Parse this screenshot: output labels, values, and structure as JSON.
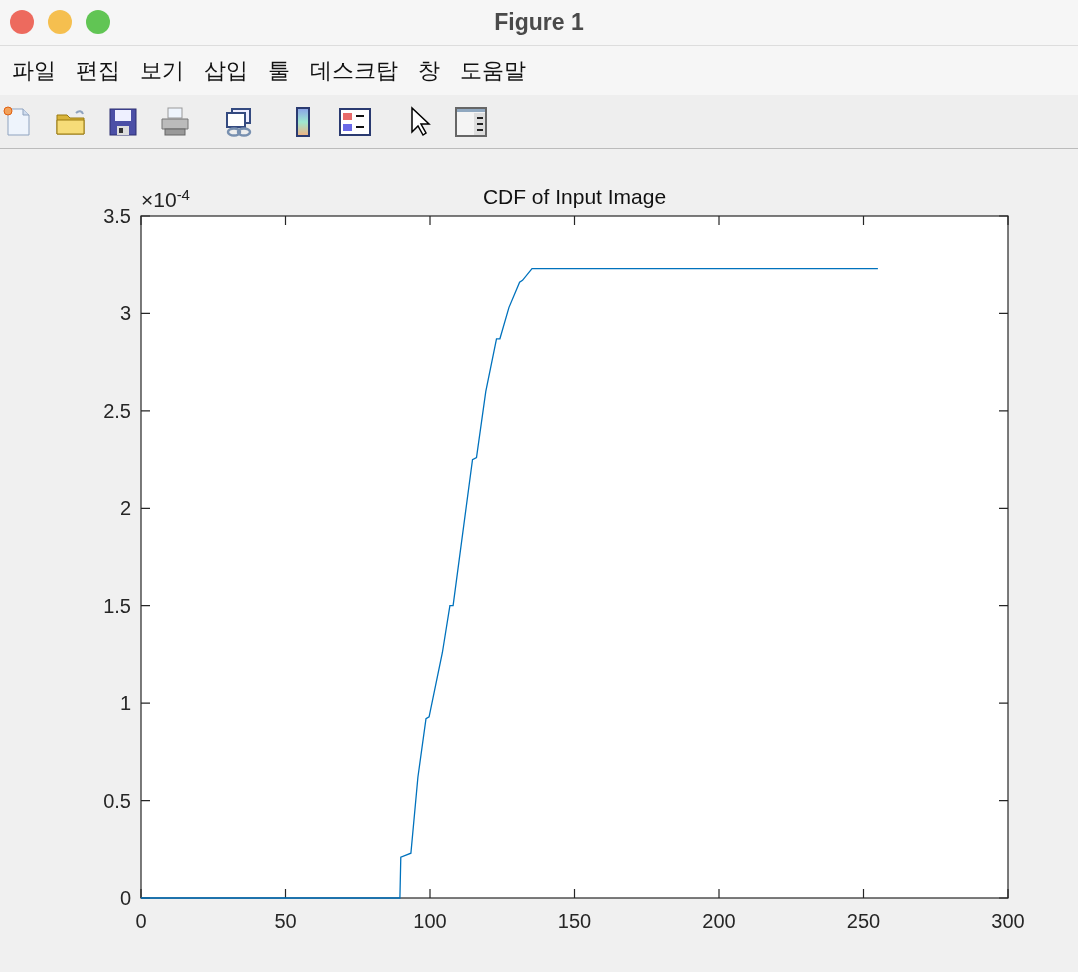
{
  "window": {
    "title": "Figure 1"
  },
  "menu": [
    "파일",
    "편집",
    "보기",
    "삽입",
    "툴",
    "데스크탑",
    "창",
    "도움말"
  ],
  "toolbar": [
    {
      "kind": "new"
    },
    {
      "kind": "open"
    },
    {
      "kind": "save"
    },
    {
      "kind": "print"
    },
    {
      "kind": "link"
    },
    {
      "kind": "colorbar"
    },
    {
      "kind": "legend"
    },
    {
      "kind": "pointer"
    },
    {
      "kind": "panel"
    }
  ],
  "axes": {
    "exponent_label": "×10$^{-4}$",
    "chart_data": {
      "type": "line",
      "title": "CDF of Input Image",
      "x": [
        0,
        89.6,
        89.9,
        93.4,
        95.8,
        98.6,
        99.7,
        104.3,
        106.9,
        108,
        114.7,
        116.1,
        119.3,
        123,
        124.2,
        127.3,
        131,
        132,
        135.3,
        255
      ],
      "series": [
        {
          "color": "#0072bd",
          "values": [
            0,
            0,
            0.21,
            0.23,
            0.62,
            0.92,
            0.93,
            1.26,
            1.5,
            1.5,
            2.25,
            2.26,
            2.6,
            2.87,
            2.87,
            3.03,
            3.16,
            3.17,
            3.23,
            3.23
          ]
        }
      ],
      "xlim": [
        0,
        300
      ],
      "ylim": [
        0,
        3.5
      ],
      "xticks": [
        0,
        50,
        100,
        150,
        200,
        250,
        300
      ],
      "yticks": [
        0,
        0.5,
        1,
        1.5,
        2,
        2.5,
        3,
        3.5
      ]
    }
  }
}
